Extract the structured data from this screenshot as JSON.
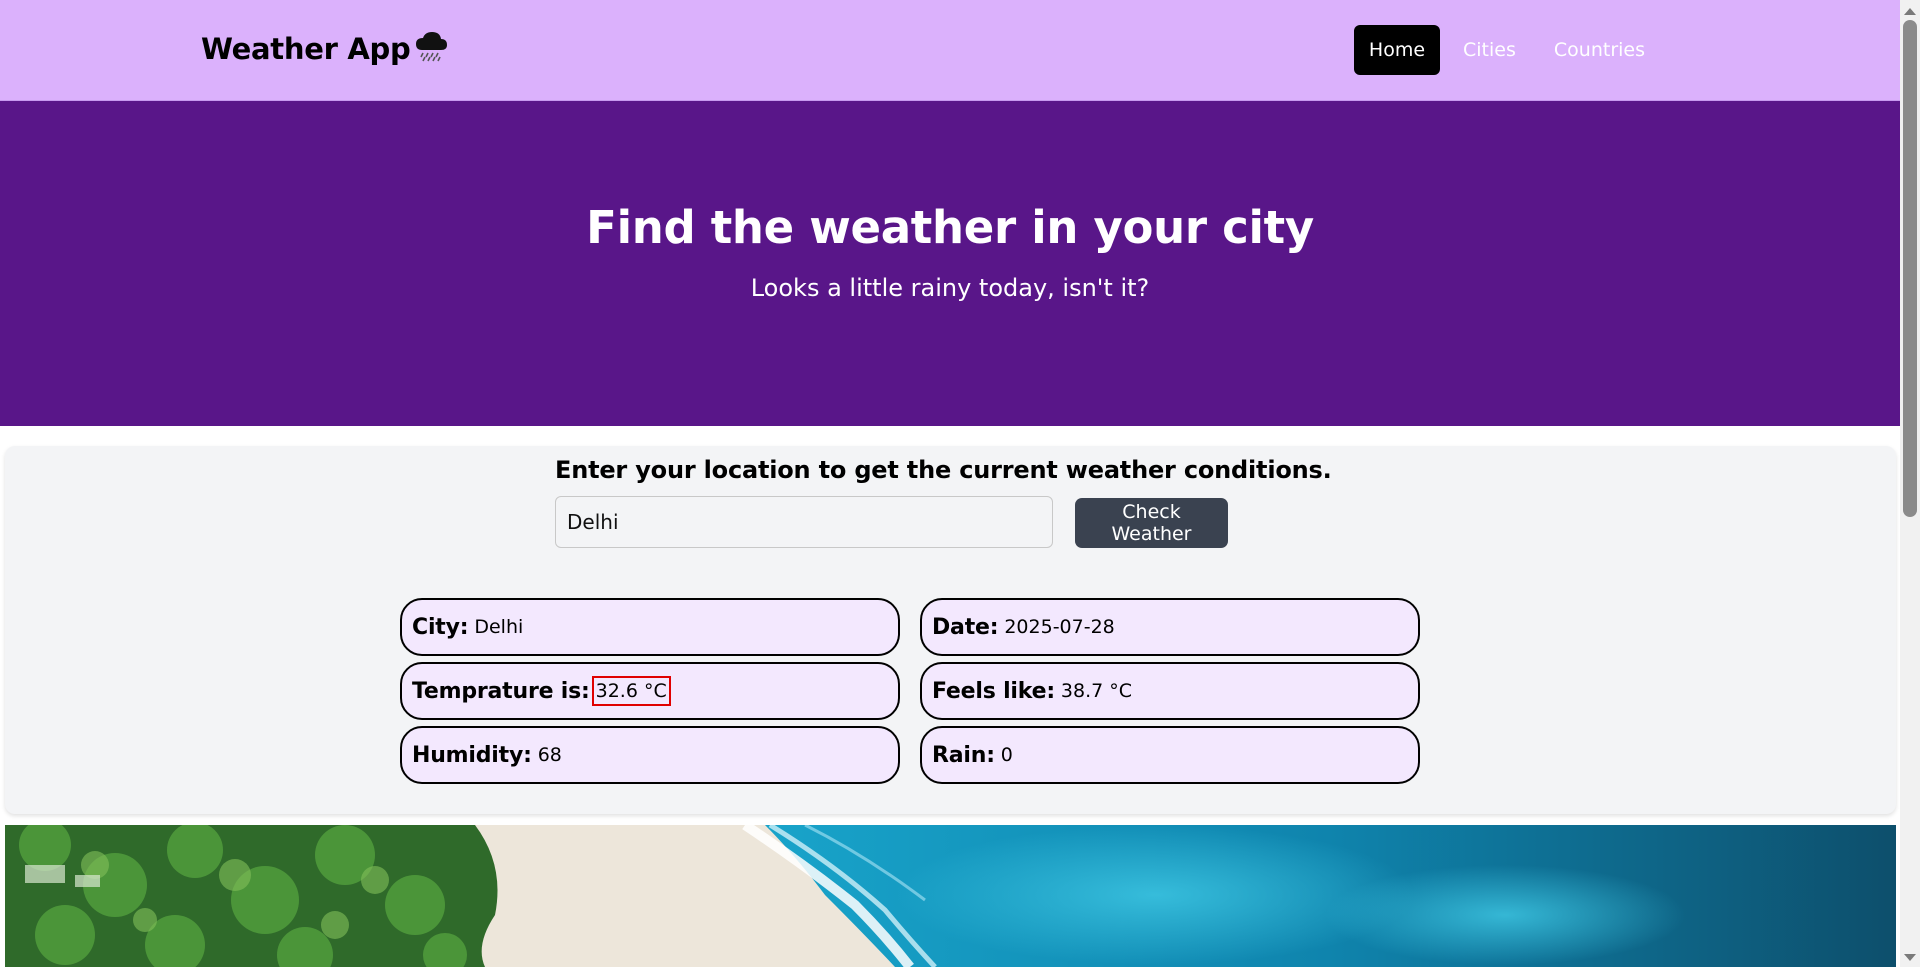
{
  "navbar": {
    "brand": "Weather App",
    "brand_icon": "rain-cloud-icon",
    "links": [
      {
        "label": "Home",
        "active": true
      },
      {
        "label": "Cities",
        "active": false
      },
      {
        "label": "Countries",
        "active": false
      }
    ]
  },
  "hero": {
    "title": "Find the weather in your city",
    "subtitle": "Looks a little rainy today, isn't it?"
  },
  "search": {
    "title": "Enter your location to get the current weather conditions.",
    "input_value": "Delhi",
    "button_label": "Check Weather"
  },
  "results": {
    "city_label": "City:",
    "city_value": "Delhi",
    "date_label": "Date:",
    "date_value": "2025-07-28",
    "temp_label": "Temprature is:",
    "temp_value": "32.6 °C",
    "feels_label": "Feels like:",
    "feels_value": "38.7 °C",
    "humidity_label": "Humidity:",
    "humidity_value": "68",
    "rain_label": "Rain:",
    "rain_value": "0"
  },
  "colors": {
    "navbar_bg": "#dbb1fc",
    "hero_bg": "#591689",
    "pill_bg": "#f3e8fe",
    "button_bg": "#3a4250",
    "highlight_border": "#e00000"
  }
}
